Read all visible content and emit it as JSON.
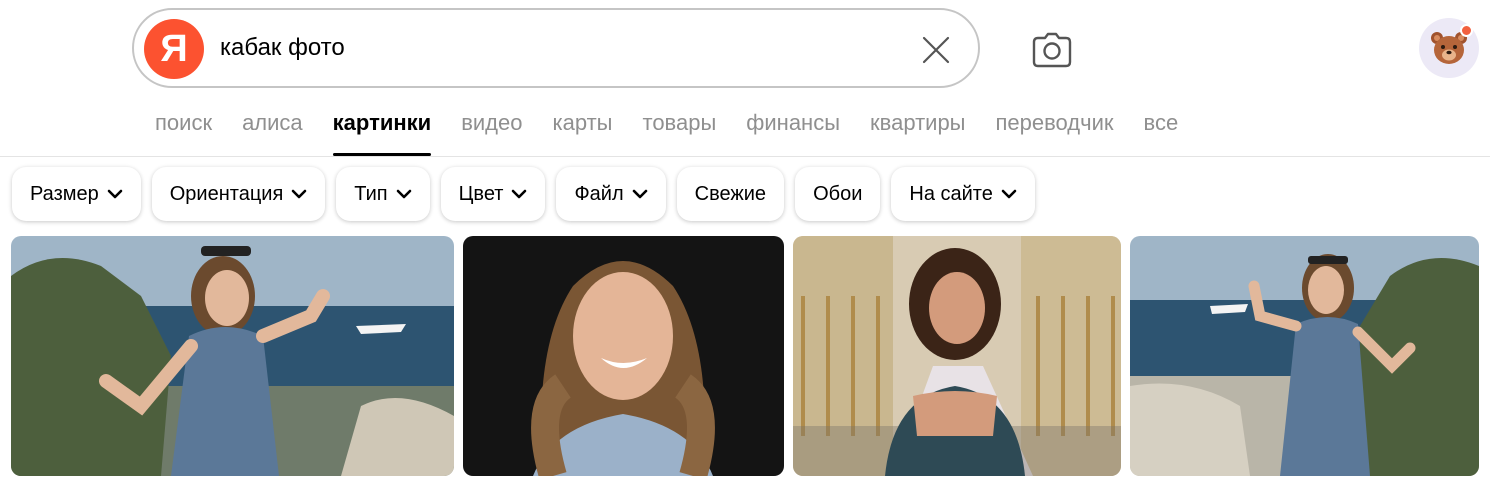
{
  "search": {
    "logo_letter": "Я",
    "query": "кабак фото"
  },
  "tabs": [
    {
      "label": "поиск"
    },
    {
      "label": "алиса"
    },
    {
      "label": "картинки",
      "active": true
    },
    {
      "label": "видео"
    },
    {
      "label": "карты"
    },
    {
      "label": "товары"
    },
    {
      "label": "финансы"
    },
    {
      "label": "квартиры"
    },
    {
      "label": "переводчик"
    },
    {
      "label": "все"
    }
  ],
  "filters": [
    {
      "label": "Размер",
      "dropdown": true
    },
    {
      "label": "Ориентация",
      "dropdown": true
    },
    {
      "label": "Тип",
      "dropdown": true
    },
    {
      "label": "Цвет",
      "dropdown": true
    },
    {
      "label": "Файл",
      "dropdown": true
    },
    {
      "label": "Свежие",
      "dropdown": false
    },
    {
      "label": "Обои",
      "dropdown": false
    },
    {
      "label": "На сайте",
      "dropdown": true
    }
  ],
  "icons": {
    "clear": "close-icon",
    "camera": "camera-icon",
    "avatar": "bear-avatar-icon",
    "chevron": "chevron-down-icon"
  },
  "colors": {
    "brand": "#fc5230",
    "notification_dot": "#f2603f",
    "tab_inactive": "#8f8f8f"
  },
  "results": [
    {
      "scene": "woman in blue polka-dot dress at seaside with yacht"
    },
    {
      "scene": "smiling woman with long hair on dark background"
    },
    {
      "scene": "woman in dark top at outdoor venue with chairs"
    },
    {
      "scene": "woman in blue dress at seaside, mirrored"
    }
  ]
}
